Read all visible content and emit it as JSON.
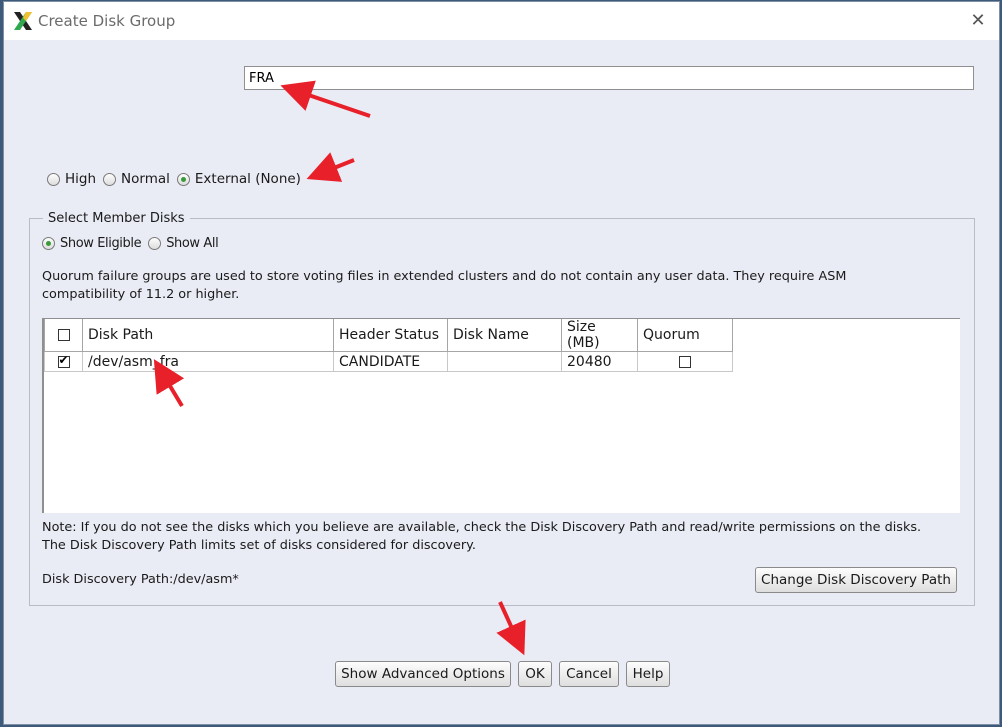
{
  "window": {
    "title": "Create Disk Group",
    "close_glyph": "✕"
  },
  "disk_group_name": {
    "value": "FRA"
  },
  "redundancy": {
    "options": [
      "High",
      "Normal",
      "External (None)"
    ],
    "selected": "External (None)"
  },
  "member_disks": {
    "legend": "Select Member Disks",
    "filter_options": [
      "Show Eligible",
      "Show All"
    ],
    "filter_selected": "Show Eligible",
    "quorum_note_line1": "Quorum failure groups are used to store voting files in extended clusters and do not contain any user data. They require ASM",
    "quorum_note_line2": "compatibility of 11.2 or higher.",
    "table": {
      "columns": [
        "Disk Path",
        "Header Status",
        "Disk Name",
        "Size (MB)",
        "Quorum"
      ],
      "rows": [
        {
          "selected": true,
          "disk_path": "/dev/asm_fra",
          "header_status": "CANDIDATE",
          "disk_name": "",
          "size_mb": "20480",
          "quorum": false
        }
      ]
    },
    "discovery_note_line1": "Note: If you do not see the disks which you believe are available, check the Disk Discovery Path and read/write permissions on the disks.",
    "discovery_note_line2": "The Disk Discovery Path limits set of disks considered for discovery.",
    "discovery_path_label": "Disk Discovery Path:/dev/asm*",
    "change_path_button": "Change Disk Discovery Path"
  },
  "buttons": {
    "advanced": "Show Advanced Options",
    "ok": "OK",
    "cancel": "Cancel",
    "help": "Help"
  },
  "colors": {
    "annotation_arrow": "#e8202a",
    "radio_selected": "#3a9a3a",
    "dialog_bg": "#e9ecf5"
  }
}
